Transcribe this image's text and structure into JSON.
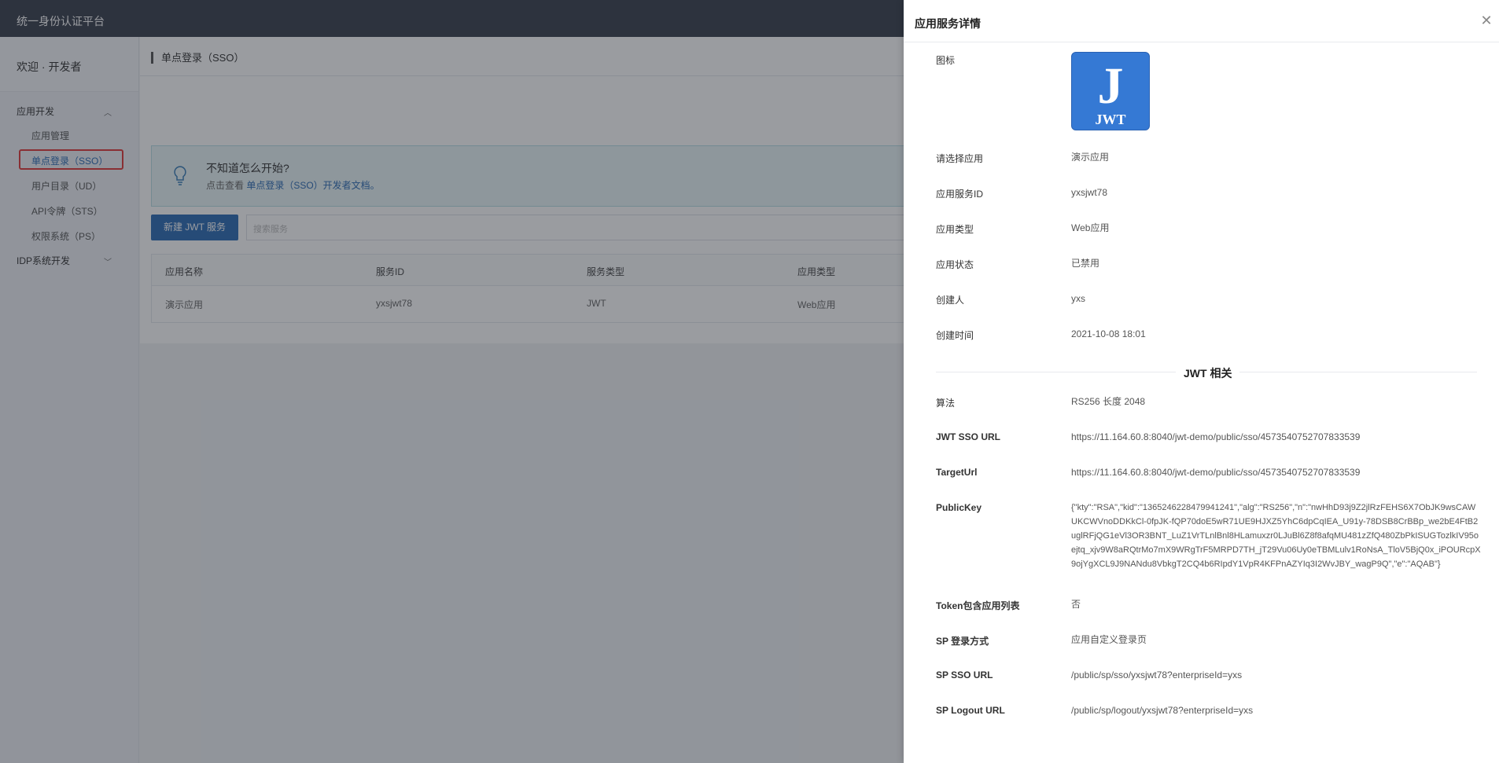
{
  "app": {
    "title": "统一身份认证平台"
  },
  "sidebar": {
    "welcome": "欢迎 · 开发者",
    "groups": [
      {
        "label": "应用开发",
        "chevron": "chevron-up-icon",
        "items": [
          {
            "label": "应用管理"
          },
          {
            "label": "单点登录（SSO）"
          },
          {
            "label": "用户目录（UD）"
          },
          {
            "label": "API令牌（STS）"
          },
          {
            "label": "权限系统（PS）"
          }
        ]
      },
      {
        "label": "IDP系统开发",
        "chevron": "chevron-down-icon"
      }
    ]
  },
  "main": {
    "breadcrumb": "单点登录（SSO）",
    "tip": {
      "title": "不知道怎么开始?",
      "prefix": "点击查看 ",
      "link": "单点登录（SSO）开发者文档。"
    },
    "new_button": "新建 JWT 服务",
    "search_placeholder": "搜索服务",
    "table": {
      "headers": [
        "应用名称",
        "服务ID",
        "服务类型",
        "应用类型"
      ],
      "rows": [
        [
          "演示应用",
          "yxsjwt78",
          "JWT",
          "Web应用"
        ]
      ]
    }
  },
  "drawer": {
    "title": "应用服务详情",
    "icon_label": "图标",
    "icon_letter": "J",
    "icon_text": "JWT",
    "fields": {
      "app": {
        "label": "请选择应用",
        "value": "演示应用"
      },
      "service_id": {
        "label": "应用服务ID",
        "value": "yxsjwt78"
      },
      "app_type": {
        "label": "应用类型",
        "value": "Web应用"
      },
      "app_status": {
        "label": "应用状态",
        "value": "已禁用"
      },
      "creator": {
        "label": "创建人",
        "value": "yxs"
      },
      "created_at": {
        "label": "创建时间",
        "value": "2021-10-08 18:01"
      }
    },
    "section": "JWT 相关",
    "jwt": {
      "algorithm": {
        "label": "算法",
        "value": "RS256 长度 2048"
      },
      "sso_url": {
        "label": "JWT SSO URL",
        "value": "https://11.164.60.8:8040/jwt-demo/public/sso/4573540752707833539"
      },
      "target_url": {
        "label": "TargetUrl",
        "value": "https://11.164.60.8:8040/jwt-demo/public/sso/4573540752707833539"
      },
      "public_key": {
        "label": "PublicKey",
        "value": "{\"kty\":\"RSA\",\"kid\":\"1365246228479941241\",\"alg\":\"RS256\",\"n\":\"nwHhD93j9Z2jlRzFEHS6X7ObJK9wsCAWUKCWVnoDDKkCl-0fpJK-fQP70doE5wR71UE9HJXZ5YhC6dpCqIEA_U91y-78DSB8CrBBp_we2bE4FtB2uglRFjQG1eVl3OR3BNT_LuZ1VrTLnlBnl8HLamuxzr0LJuBl6Z8f8afqMU481zZfQ480ZbPkISUGTozlkIV95oejtq_xjv9W8aRQtrMo7mX9WRgTrF5MRPD7TH_jT29Vu06Uy0eTBMLulv1RoNsA_TloV5BjQ0x_iPOURcpX9ojYgXCL9J9NANdu8VbkgT2CQ4b6RIpdY1VpR4KFPnAZYIq3I2WvJBY_wagP9Q\",\"e\":\"AQAB\"}"
      },
      "token_apps": {
        "label": "Token包含应用列表",
        "value": "否"
      },
      "sp_login": {
        "label": "SP 登录方式",
        "value": "应用自定义登录页"
      },
      "sp_sso_url": {
        "label": "SP SSO URL",
        "value": "/public/sp/sso/yxsjwt78?enterpriseId=yxs"
      },
      "sp_logout_url": {
        "label": "SP Logout URL",
        "value": "/public/sp/logout/yxsjwt78?enterpriseId=yxs"
      }
    }
  }
}
